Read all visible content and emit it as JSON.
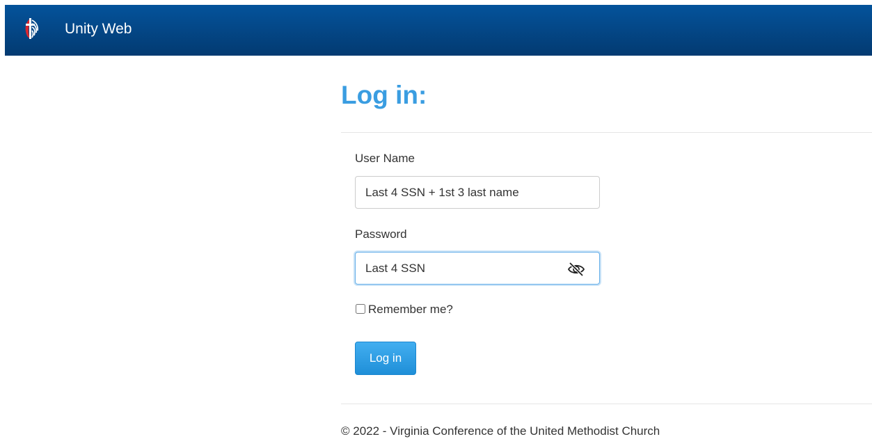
{
  "navbar": {
    "brand": "Unity Web",
    "logo_icon": "cross-and-flame-icon"
  },
  "login": {
    "title": "Log in:",
    "username": {
      "label": "User Name",
      "value": "Last 4 SSN + 1st 3 last name"
    },
    "password": {
      "label": "Password",
      "value": "Last 4 SSN",
      "toggle_icon": "eye-slash-icon"
    },
    "remember_label": "Remember me?",
    "submit_label": "Log in"
  },
  "footer": {
    "text": "© 2022 - Virginia Conference of the United Methodist Church"
  },
  "colors": {
    "navbar": "#04539b",
    "heading": "#3a9de1",
    "button": "#2a9be3"
  }
}
